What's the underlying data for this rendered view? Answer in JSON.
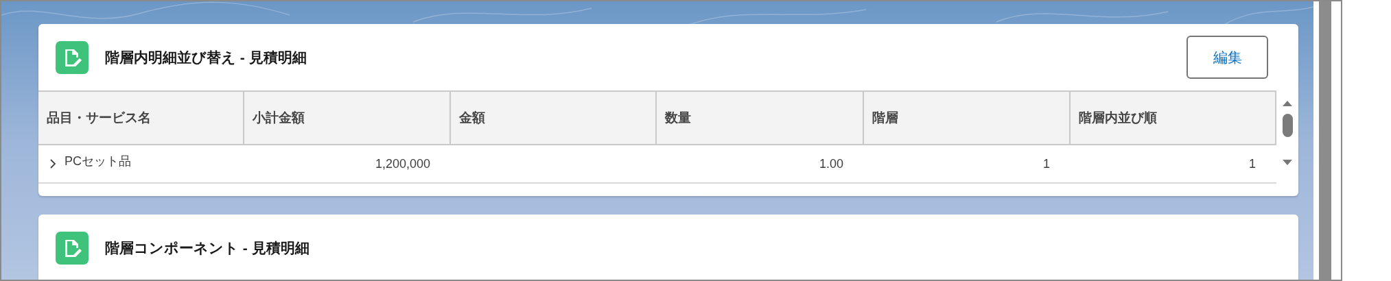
{
  "cards": [
    {
      "title": "階層内明細並び替え - 見積明細",
      "button": "編集",
      "table": {
        "columns": [
          "品目・サービス名",
          "小計金額",
          "金額",
          "数量",
          "階層",
          "階層内並び順"
        ],
        "rows": [
          {
            "expanded": false,
            "cells": [
              "PCセット品",
              "1,200,000",
              "",
              "1.00",
              "1",
              "1"
            ]
          }
        ]
      }
    },
    {
      "title": "階層コンポーネント - 見積明細"
    }
  ]
}
